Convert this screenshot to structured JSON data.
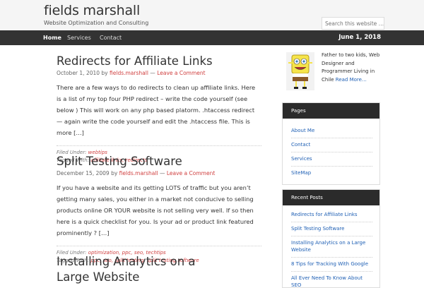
{
  "header": {
    "site_title": "fields marshall",
    "site_description": "Website Optimization and Consulting",
    "search_placeholder": "Search this website …"
  },
  "nav": {
    "items": [
      {
        "label": "Home",
        "active": true
      },
      {
        "label": "Services",
        "active": false
      },
      {
        "label": "Contact",
        "active": false
      }
    ],
    "date": "June 1, 2018"
  },
  "posts": [
    {
      "title": "Redirects for Affiliate Links",
      "date": "October 1, 2010",
      "by": "by",
      "author": "fields.marshall",
      "separator": "—",
      "comment_link": "Leave a Comment",
      "body": "There are a few ways to do redirects to clean up affiliate links. Here is a list of my top four PHP redirect – write the code yourself (see below ) This will work on any php based platorm. .htaccess redirect —  again write the code yourself and edit the .htaccess file. This is more […]",
      "filed_label": "Filed Under:",
      "filed": "webtips",
      "tagged_label": "Tagged With:",
      "tags": "affiliate links, redirects"
    },
    {
      "title": "Split Testing Software",
      "date": "December 15, 2009",
      "by": "by",
      "author": "fields.marshall",
      "separator": "—",
      "comment_link": "Leave a Comment",
      "body": "If you have a website and its getting LOTS of traffic but you aren’t getting many sales, you either in a market not conducive to selling products online OR YOUR website is not selling very well. If so then here is a quick checklist for you. Is your ad or product link featured prominently ? […]",
      "filed_label": "Filed Under:",
      "filed": "optimization, ppc, seo, techtips",
      "tagged_label": "Tagged With:",
      "tags": "ppc, seo, split testing, split testing software"
    },
    {
      "title": "Installing Analytics on a Large Website"
    }
  ],
  "sidebar": {
    "bio_text": "Father to two kids, Web Designer and Programmer Living in Chile",
    "bio_link": "Read More…",
    "avatar_icon": "spongebob-avatar",
    "pages": {
      "title": "Pages",
      "items": [
        "About Me",
        "Contact",
        "Services",
        "SiteMap"
      ]
    },
    "recent": {
      "title": "Recent Posts",
      "items": [
        "Redirects for Affiliate Links",
        "Split Testing Software",
        "Installing Analytics on a Large Website",
        "8 Tips for Tracking With Google",
        "All Ever Need To Know About SEO"
      ]
    }
  },
  "colors": {
    "nav_bg": "#333333",
    "accent_red": "#d04040",
    "link_blue": "#1e5fb4"
  }
}
